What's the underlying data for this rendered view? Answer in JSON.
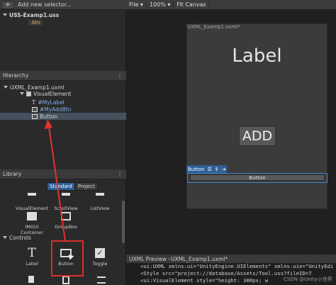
{
  "left_toolbar": {
    "add_label": "+",
    "add_selector": "Add new selector..."
  },
  "stylesheets": {
    "file": "USS-Examp1.uss",
    "selector": ".btn"
  },
  "hierarchy": {
    "title": "Hierarchy",
    "root": "UXML_Examp1.uxml",
    "items": [
      {
        "label": "VisualElement",
        "icon": "visual-element-icon"
      },
      {
        "label": "#MyLabel",
        "icon": "label-icon"
      },
      {
        "label": "#MyAddBtn",
        "icon": "button-icon"
      },
      {
        "label": "Button",
        "icon": "button-icon"
      }
    ]
  },
  "library": {
    "title": "Library",
    "tabs": [
      "Standard",
      "Project"
    ],
    "containers": [
      {
        "label": "VisualElement"
      },
      {
        "label": "ScrollView"
      },
      {
        "label": "ListView"
      },
      {
        "label": "IMGUI Container"
      },
      {
        "label": "GroupBox"
      }
    ],
    "controls_title": "Controls",
    "controls": [
      {
        "label": "Label",
        "icon": "label-icon"
      },
      {
        "label": "Button",
        "icon": "button-icon"
      },
      {
        "label": "Toggle",
        "icon": "toggle-icon"
      }
    ]
  },
  "viewport_toolbar": {
    "file": "File ▾",
    "zoom": "100% ▾",
    "fit": "Fit Canvas"
  },
  "canvas": {
    "doc_title": "UXML_Examp1.uxml*",
    "label_text": "Label",
    "add_button_text": "ADD",
    "selected_tag": "Button",
    "button_text": "Button"
  },
  "preview": {
    "title": "UXML Preview  –UXML_Examp1.uxml*",
    "lines": [
      "<ui:UXML xmlns:ui=\"UnityEngine.UIElements\" xmlns:uie=\"UnityEdi",
      "  <Style src=\"project://database/Assets/Tool.uss?fileID=7",
      "    <ui:VisualElement style=\"height: 300px; w"
    ],
    "watermark": "CSDN @Unity小世界"
  },
  "colors": {
    "selection_blue": "#2f5f96",
    "arrow_red": "#e0342e",
    "highlight_red": "#d9302c"
  }
}
